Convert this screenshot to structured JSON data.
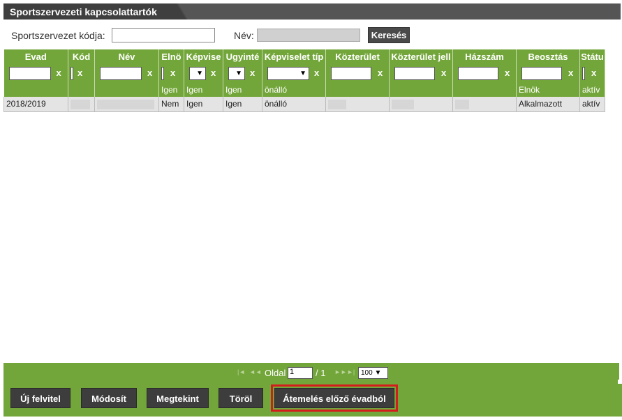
{
  "title": "Sportszervezeti kapcsolattartók",
  "search": {
    "code_label": "Sportszervezet kódja:",
    "code_value": "",
    "name_label": "Név:",
    "name_value": "",
    "button": "Keresés"
  },
  "grid": {
    "columns": [
      "Evad",
      "Kód",
      "Név",
      "Elnö",
      "Képvise",
      "Ugyinté",
      "Képviselet típ",
      "Közterület",
      "Közterület jell",
      "Házszám",
      "Beosztás",
      "Státu"
    ],
    "filter_clear": "x",
    "default_row": [
      "",
      "",
      "",
      "Igen",
      "Igen",
      "Igen",
      "önálló",
      "",
      "",
      "",
      "Elnök",
      "aktív"
    ],
    "rows": [
      [
        "2018/2019",
        "",
        "",
        "Nem",
        "Igen",
        "Igen",
        "önálló",
        "",
        "",
        "",
        "Alkalmazott",
        "aktív"
      ]
    ]
  },
  "pager": {
    "first": "|◄",
    "prev": "◄◄",
    "page_label": "Oldal",
    "page_value": "1",
    "total": "/ 1",
    "next": "►►",
    "last": "►|",
    "page_size": "100 ▼"
  },
  "footer": {
    "new": "Új felvitel",
    "modify": "Módosít",
    "view": "Megtekint",
    "delete": "Töröl",
    "transfer": "Átemelés előző évadból"
  },
  "colors": {
    "green": "#73a63a",
    "dark": "#3d3d3d",
    "highlight": "#d41c1c"
  }
}
